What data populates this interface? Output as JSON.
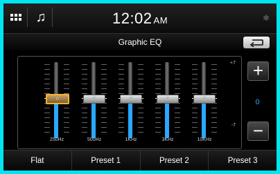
{
  "status_bar": {
    "time": "12:02",
    "ampm": "AM",
    "icons": [
      "menu-grid-icon",
      "music-settings-icon",
      "bluetooth-icon"
    ]
  },
  "title_bar": {
    "title": "Graphic EQ",
    "back_icon": "back-arrow-icon"
  },
  "eq": {
    "scale_top": "+7",
    "scale_bottom": "-7",
    "bands": [
      {
        "freq": "250Hz",
        "value": "0",
        "selected": true
      },
      {
        "freq": "500Hz",
        "value": "0",
        "selected": false
      },
      {
        "freq": "1KHz",
        "value": "0",
        "selected": false
      },
      {
        "freq": "3KHz",
        "value": "0",
        "selected": false
      },
      {
        "freq": "10KHz",
        "value": "0",
        "selected": false
      }
    ],
    "current_value": "0",
    "plus_label": "+",
    "minus_label": "−"
  },
  "presets": [
    "Flat",
    "Preset 1",
    "Preset 2",
    "Preset 3"
  ],
  "colors": {
    "frame": "#00e5ef",
    "accent": "#2aa8ff",
    "selected_border": "#f2b233"
  }
}
